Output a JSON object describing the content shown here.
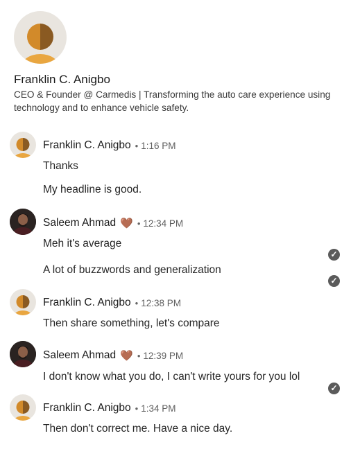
{
  "profile": {
    "name": "Franklin C. Anigbo",
    "headline": "CEO & Founder @ Carmedis | Transforming the auto care experience using technology and to enhance vehicle safety."
  },
  "groups": [
    {
      "sender": "Franklin C. Anigbo",
      "time": "1:16 PM",
      "messages": [
        "Thanks",
        "My headline is good."
      ]
    },
    {
      "sender": "Saleem Ahmad",
      "time": "12:34 PM",
      "heart": "🤎",
      "messages": [
        "Meh it's average",
        "A lot of buzzwords and generalization"
      ]
    },
    {
      "sender": "Franklin C. Anigbo",
      "time": "12:38 PM",
      "messages": [
        "Then share something, let's compare"
      ]
    },
    {
      "sender": "Saleem Ahmad",
      "time": "12:39 PM",
      "heart": "🤎",
      "messages": [
        "I don't know what you do, I can't write yours for you lol"
      ]
    },
    {
      "sender": "Franklin C. Anigbo",
      "time": "1:34 PM",
      "messages": [
        "Then don't correct me. Have a nice day."
      ]
    }
  ],
  "separator_dot": "•",
  "read_check": "✓",
  "colors": {
    "avatar_orange": "#d28a2a",
    "avatar_brown": "#8a5a22",
    "avatar_bg": "#e9e5df",
    "check_gray": "#5b5b5b"
  }
}
